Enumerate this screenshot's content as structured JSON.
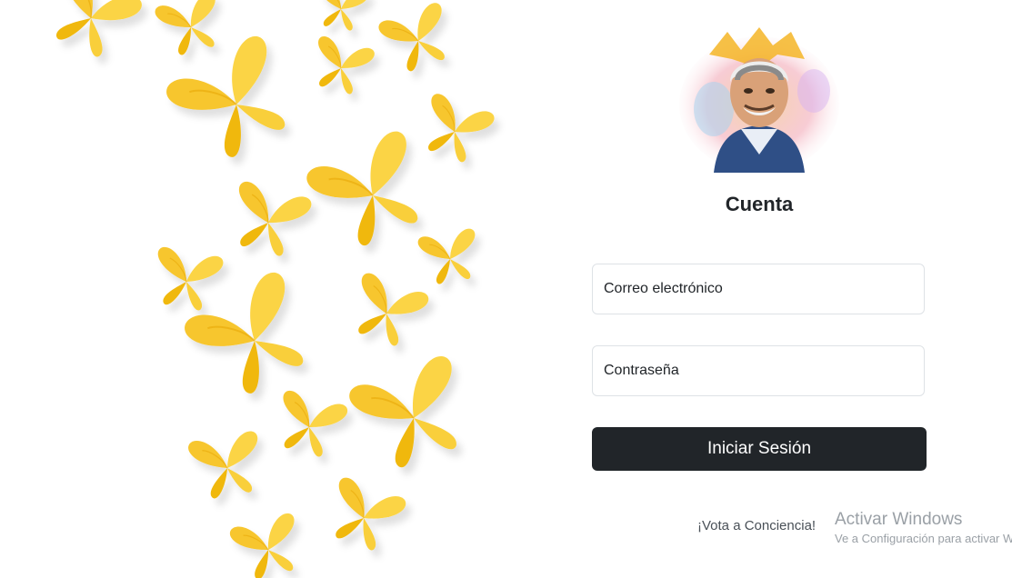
{
  "login": {
    "title": "Cuenta",
    "email_placeholder": "Correo electrónico",
    "password_placeholder": "Contraseña",
    "submit_label": "Iniciar Sesión",
    "vote_link": "¡Vota a Conciencia!"
  },
  "windows_watermark": {
    "title": "Activar Windows",
    "subtitle": "Ve a Configuración para activar Windows."
  },
  "colors": {
    "button_bg": "#212529",
    "butterfly": "#f7c62f",
    "butterfly_dark": "#e8a909",
    "field_border": "#dee2e6"
  }
}
